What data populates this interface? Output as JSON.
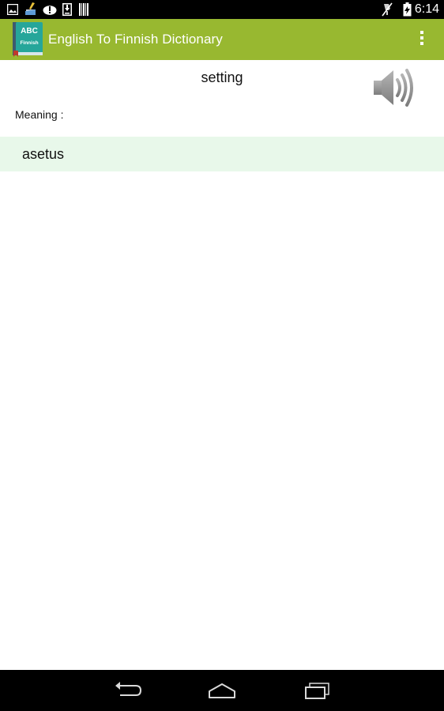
{
  "status_bar": {
    "time": "6:14",
    "left_icons": [
      "image-icon",
      "cleaner-icon",
      "cloud-icon",
      "download-icon",
      "barcode-icon"
    ],
    "right_icons": [
      "mute-icon",
      "battery-icon"
    ]
  },
  "action_bar": {
    "title": "English To Finnish Dictionary",
    "logo_text_top": "ABC",
    "logo_text_bottom": "Finnish",
    "color": "#98b830"
  },
  "content": {
    "word": "setting",
    "meaning_label": "Meaning :",
    "meaning": "asetus",
    "meaning_row_color": "#e8f8ea"
  },
  "nav_bar": {
    "buttons": [
      "back-icon",
      "home-icon",
      "recent-apps-icon"
    ]
  }
}
